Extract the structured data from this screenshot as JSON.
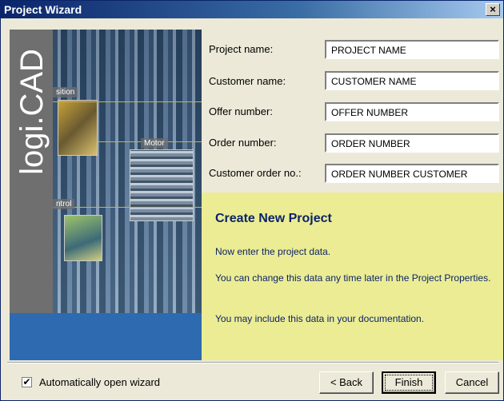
{
  "window": {
    "title": "Project Wizard",
    "close_glyph": "×"
  },
  "banner": {
    "logo": "logi.CAD",
    "labels": {
      "position": "sition",
      "motor": "Motor",
      "control": "ntrol"
    }
  },
  "form": {
    "project_name": {
      "label": "Project name:",
      "value": "PROJECT NAME"
    },
    "customer_name": {
      "label": "Customer name:",
      "value": "CUSTOMER NAME"
    },
    "offer_number": {
      "label": "Offer number:",
      "value": "OFFER NUMBER"
    },
    "order_number": {
      "label": "Order number:",
      "value": "ORDER NUMBER"
    },
    "customer_order_no": {
      "label": "Customer order no.:",
      "value": "ORDER NUMBER CUSTOMER"
    }
  },
  "info": {
    "title": "Create New Project",
    "line1": "Now enter the project data.",
    "line2": "You can change this data any time later in the Project Properties.",
    "line3": "You may include this data in your documentation."
  },
  "footer": {
    "auto_open_checked": true,
    "auto_open_label": "Automatically open wizard",
    "check_glyph": "✔",
    "back_label": "< Back",
    "finish_label": "Finish",
    "cancel_label": "Cancel"
  }
}
